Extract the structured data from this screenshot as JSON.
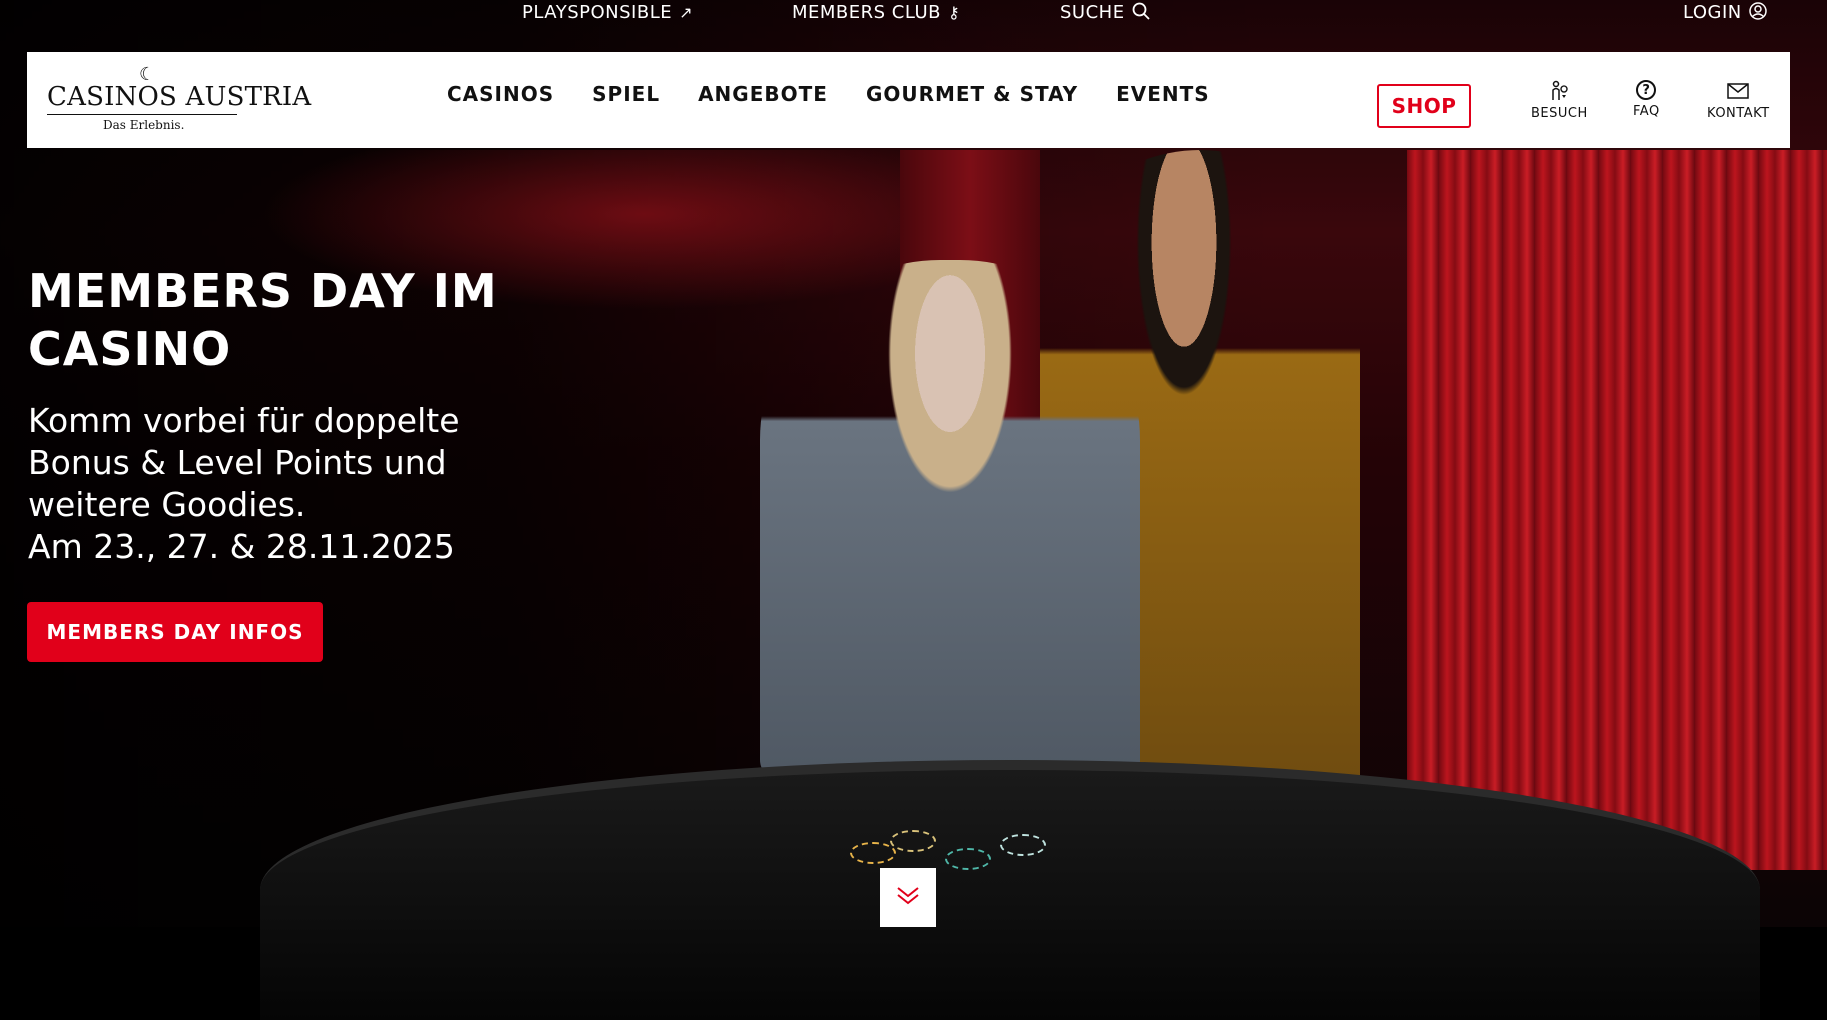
{
  "topbar": {
    "playsponsible": "PLAYSPONSIBLE",
    "members_club": "MEMBERS CLUB",
    "suche": "SUCHE",
    "login": "LOGIN",
    "icons": {
      "playsponsible": "external-arrow-icon",
      "members_club": "key-icon",
      "suche": "search-icon",
      "login": "user-circle-icon"
    }
  },
  "logo": {
    "brand": "CASINOS AUSTRIA",
    "tagline": "Das Erlebnis."
  },
  "nav": {
    "items": [
      "CASINOS",
      "SPIEL",
      "ANGEBOTE",
      "GOURMET & STAY",
      "EVENTS"
    ],
    "shop": "SHOP",
    "utility": [
      {
        "label": "BESUCH",
        "icon": "location-person-icon"
      },
      {
        "label": "FAQ",
        "icon": "question-circle-icon"
      },
      {
        "label": "KONTAKT",
        "icon": "envelope-icon"
      }
    ]
  },
  "hero": {
    "title": "MEMBERS DAY IM CASINO",
    "subtitle": "Komm vorbei für doppelte Bonus & Level Points und weitere Goodies.",
    "date": "Am 23., 27. & 28.11.2025",
    "cta": "MEMBERS DAY INFOS",
    "scroll_icon": "double-chevron-down-icon"
  },
  "colors": {
    "accent": "#e1001a",
    "topbar_bg": "#000000",
    "nav_bg": "#ffffff"
  }
}
